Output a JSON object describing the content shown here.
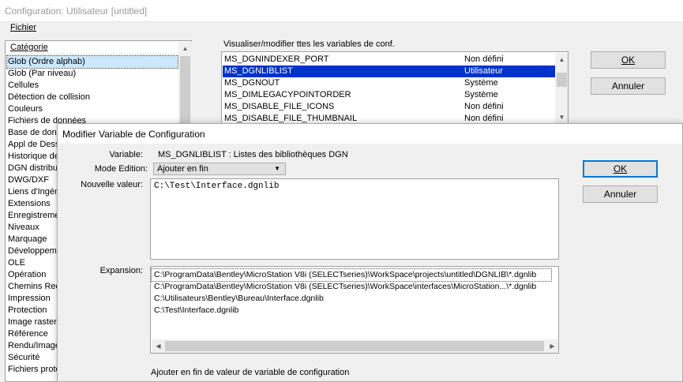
{
  "window": {
    "title": "Configuration: Utilisateur [untitled]",
    "menu": {
      "file_label": "Fichier"
    }
  },
  "categories": {
    "header": "Catégorie",
    "items": [
      "Glob (Ordre alphab)",
      "Glob (Par niveau)",
      "Cellules",
      "Détection de collision",
      "Couleurs",
      "Fichiers de données",
      "Base de donn",
      "Appl de Dessi",
      "Historique de",
      "DGN distribué",
      "DWG/DXF",
      "Liens d'Ingéni",
      "Extensions",
      "Enregistremer",
      "Niveaux",
      "Marquage",
      "Développeme",
      "OLE",
      "Opération",
      "Chemins Rech",
      "Impression",
      "Protection",
      "Image raster",
      "Référence",
      "Rendu/Image",
      "Sécurité",
      "Fichiers protot"
    ],
    "selected_index": 0
  },
  "variables": {
    "label": "Visualiser/modifier ttes les variables de conf.",
    "rows": [
      {
        "name": "MS_DGNINDEXER_PORT",
        "status": "Non défini"
      },
      {
        "name": "MS_DGNLIBLIST",
        "status": "Utilisateur"
      },
      {
        "name": "MS_DGNOUT",
        "status": "Système"
      },
      {
        "name": "MS_DIMLEGACYPOINTORDER",
        "status": "Système"
      },
      {
        "name": "MS_DISABLE_FILE_ICONS",
        "status": "Non défini"
      },
      {
        "name": "MS_DISABLE_FILE_THUMBNAIL",
        "status": "Non défini"
      }
    ],
    "selected_index": 1
  },
  "buttons": {
    "ok": "OK",
    "cancel": "Annuler"
  },
  "dialog": {
    "title": "Modifier Variable de Configuration",
    "variable_label": "Variable:",
    "variable_value": "MS_DGNLIBLIST : Listes des bibliothèques DGN",
    "mode_label": "Mode Edition:",
    "mode_value": "Ajouter en fin",
    "new_value_label": "Nouvelle valeur:",
    "new_value": "C:\\Test\\Interface.dgnlib",
    "expansion_label": "Expansion:",
    "expansion": [
      "C:\\ProgramData\\Bentley\\MicroStation V8i (SELECTseries)\\WorkSpace\\projects\\untitled\\DGNLIB\\*.dgnlib",
      "C:\\ProgramData\\Bentley\\MicroStation V8i (SELECTseries)\\WorkSpace\\interfaces\\MicroStation...\\*.dgnlib",
      "C:\\Utilisateurs\\Bentley\\Bureau\\Interface.dgnlib",
      "C:\\Test\\Interface.dgnlib"
    ],
    "ok": "OK",
    "cancel": "Annuler",
    "status": "Ajouter en fin de valeur de variable de configuration"
  },
  "colors": {
    "selection": "#0033cc",
    "default_button_border": "#0078d7"
  }
}
